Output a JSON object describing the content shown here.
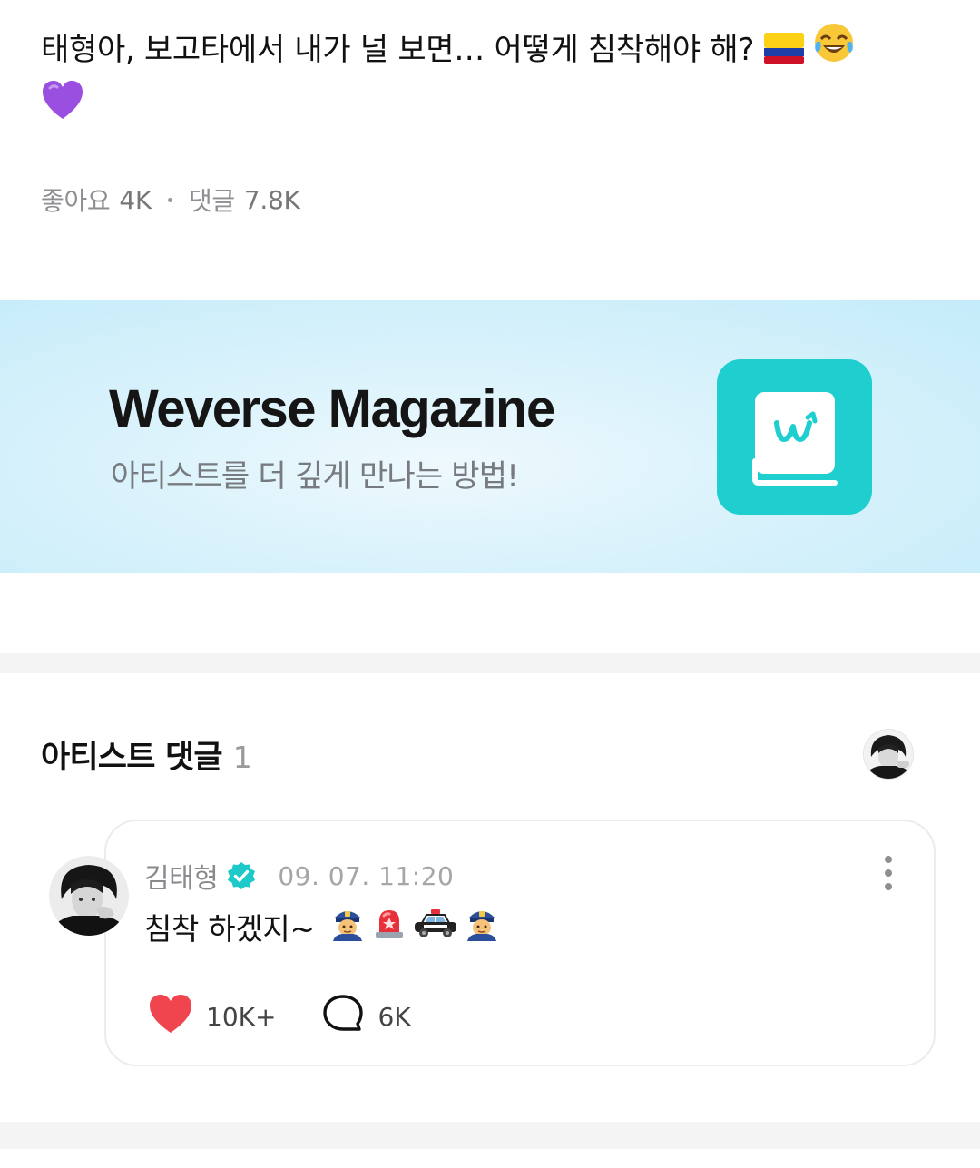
{
  "post": {
    "text": "태형아, 보고타에서 내가 널 보면… 어떻게 침착해야 해?",
    "emojis": [
      "colombia-flag-icon",
      "tears-of-joy-icon",
      "purple-heart-icon"
    ],
    "likes_label": "좋아요",
    "likes_count": "4K",
    "comments_label": "댓글",
    "comments_count": "7.8K"
  },
  "banner": {
    "title": "Weverse Magazine",
    "subtitle": "아티스트를 더 깊게 만나는 방법!",
    "icon": "weverse-magazine-book-icon",
    "icon_color": "#1fcfcf"
  },
  "artist_comments": {
    "title": "아티스트 댓글",
    "count": "1"
  },
  "comment": {
    "author": "김태형",
    "verified": true,
    "timestamp": "09. 07. 11:20",
    "text": "침착 하겠지~",
    "emojis": [
      "police-officer-icon",
      "siren-icon",
      "police-car-icon",
      "police-officer-icon"
    ],
    "likes": "10K+",
    "replies": "6K",
    "accent_color": "#f0454f",
    "verified_color": "#1dc9c9"
  }
}
